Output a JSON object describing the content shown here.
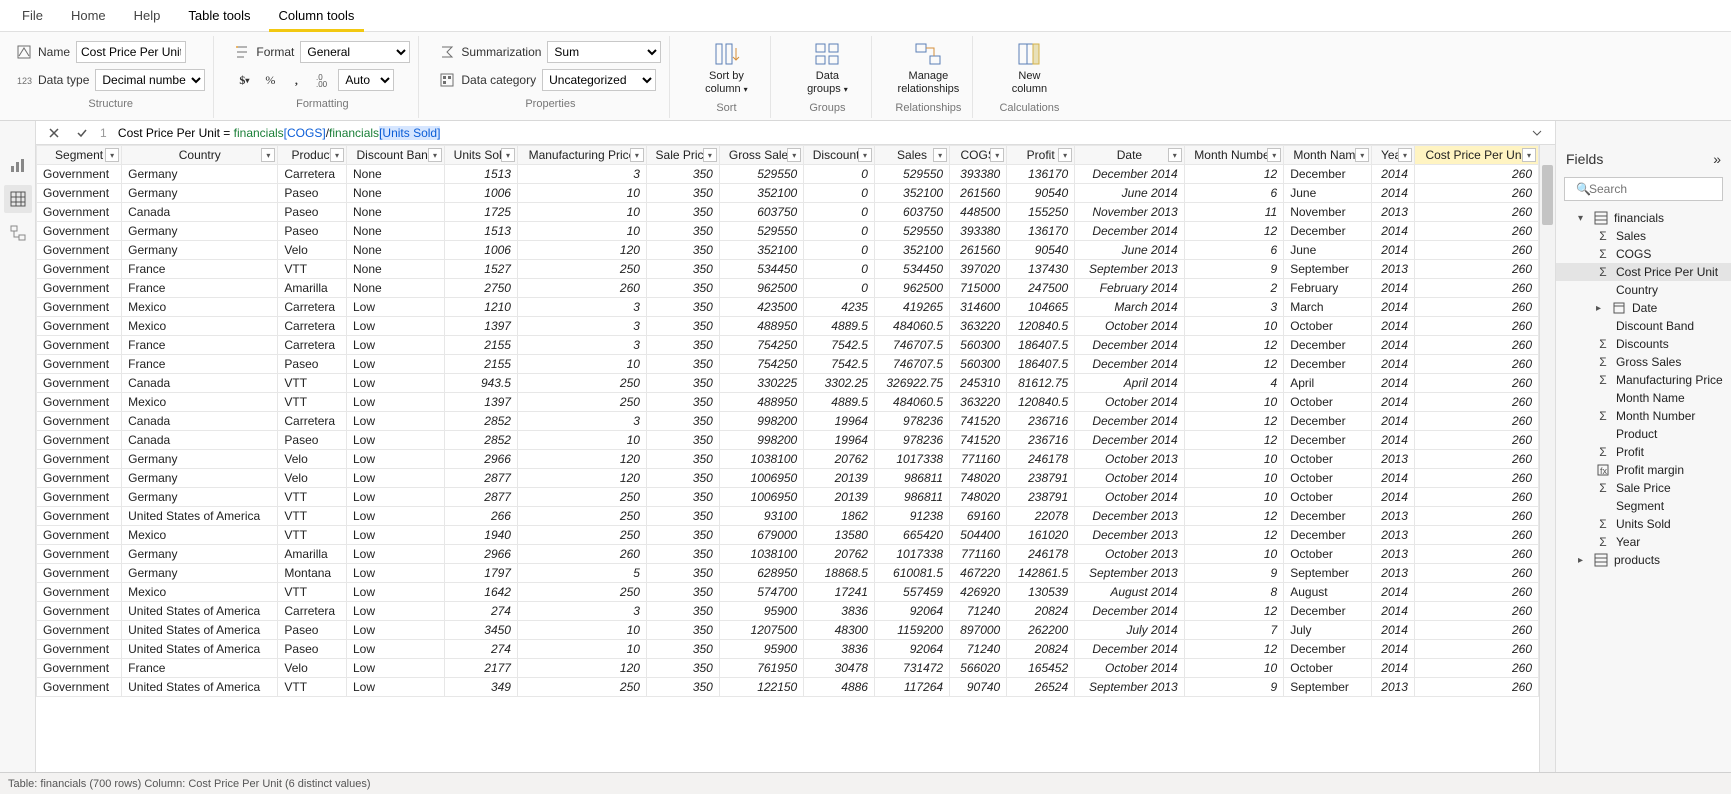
{
  "tabs": {
    "file": "File",
    "home": "Home",
    "help": "Help",
    "tabletools": "Table tools",
    "columntools": "Column tools"
  },
  "ribbon": {
    "structure": {
      "name_label": "Name",
      "name_value": "Cost Price Per Unit",
      "datatype_label": "Data type",
      "datatype_value": "Decimal number",
      "caption": "Structure"
    },
    "formatting": {
      "format_label": "Format",
      "format_value": "General",
      "auto_value": "Auto",
      "caption": "Formatting"
    },
    "properties": {
      "summarization_label": "Summarization",
      "summarization_value": "Sum",
      "datacategory_label": "Data category",
      "datacategory_value": "Uncategorized",
      "caption": "Properties"
    },
    "sort": {
      "label": "Sort by\ncolumn",
      "caption": "Sort"
    },
    "groups": {
      "label": "Data\ngroups",
      "caption": "Groups"
    },
    "relationships": {
      "label": "Manage\nrelationships",
      "caption": "Relationships"
    },
    "calculations": {
      "label": "New\ncolumn",
      "caption": "Calculations"
    }
  },
  "formula": {
    "lineno": "1",
    "lhs": "Cost Price Per Unit = ",
    "ref1": "financials",
    "col1": "[COGS]",
    "slash": "/",
    "ref2": "financials",
    "col2": "[Units Sold]"
  },
  "columns": [
    "Segment",
    "Country",
    "Product",
    "Discount Band",
    "Units Sold",
    "Manufacturing Price",
    "Sale Price",
    "Gross Sales",
    "Discounts",
    "Sales",
    "COGS",
    "Profit",
    "Date",
    "Month Number",
    "Month Name",
    "Year",
    "Cost Price Per Unit"
  ],
  "col_align": [
    "text",
    "text",
    "text",
    "text",
    "num",
    "num",
    "num",
    "num",
    "num",
    "num",
    "num",
    "num",
    "num",
    "num",
    "text",
    "num",
    "num"
  ],
  "rows": [
    [
      "Government",
      "Germany",
      "Carretera",
      "None",
      "1513",
      "3",
      "350",
      "529550",
      "0",
      "529550",
      "393380",
      "136170",
      "December 2014",
      "12",
      "December",
      "2014",
      "260"
    ],
    [
      "Government",
      "Germany",
      "Paseo",
      "None",
      "1006",
      "10",
      "350",
      "352100",
      "0",
      "352100",
      "261560",
      "90540",
      "June 2014",
      "6",
      "June",
      "2014",
      "260"
    ],
    [
      "Government",
      "Canada",
      "Paseo",
      "None",
      "1725",
      "10",
      "350",
      "603750",
      "0",
      "603750",
      "448500",
      "155250",
      "November 2013",
      "11",
      "November",
      "2013",
      "260"
    ],
    [
      "Government",
      "Germany",
      "Paseo",
      "None",
      "1513",
      "10",
      "350",
      "529550",
      "0",
      "529550",
      "393380",
      "136170",
      "December 2014",
      "12",
      "December",
      "2014",
      "260"
    ],
    [
      "Government",
      "Germany",
      "Velo",
      "None",
      "1006",
      "120",
      "350",
      "352100",
      "0",
      "352100",
      "261560",
      "90540",
      "June 2014",
      "6",
      "June",
      "2014",
      "260"
    ],
    [
      "Government",
      "France",
      "VTT",
      "None",
      "1527",
      "250",
      "350",
      "534450",
      "0",
      "534450",
      "397020",
      "137430",
      "September 2013",
      "9",
      "September",
      "2013",
      "260"
    ],
    [
      "Government",
      "France",
      "Amarilla",
      "None",
      "2750",
      "260",
      "350",
      "962500",
      "0",
      "962500",
      "715000",
      "247500",
      "February 2014",
      "2",
      "February",
      "2014",
      "260"
    ],
    [
      "Government",
      "Mexico",
      "Carretera",
      "Low",
      "1210",
      "3",
      "350",
      "423500",
      "4235",
      "419265",
      "314600",
      "104665",
      "March 2014",
      "3",
      "March",
      "2014",
      "260"
    ],
    [
      "Government",
      "Mexico",
      "Carretera",
      "Low",
      "1397",
      "3",
      "350",
      "488950",
      "4889.5",
      "484060.5",
      "363220",
      "120840.5",
      "October 2014",
      "10",
      "October",
      "2014",
      "260"
    ],
    [
      "Government",
      "France",
      "Carretera",
      "Low",
      "2155",
      "3",
      "350",
      "754250",
      "7542.5",
      "746707.5",
      "560300",
      "186407.5",
      "December 2014",
      "12",
      "December",
      "2014",
      "260"
    ],
    [
      "Government",
      "France",
      "Paseo",
      "Low",
      "2155",
      "10",
      "350",
      "754250",
      "7542.5",
      "746707.5",
      "560300",
      "186407.5",
      "December 2014",
      "12",
      "December",
      "2014",
      "260"
    ],
    [
      "Government",
      "Canada",
      "VTT",
      "Low",
      "943.5",
      "250",
      "350",
      "330225",
      "3302.25",
      "326922.75",
      "245310",
      "81612.75",
      "April 2014",
      "4",
      "April",
      "2014",
      "260"
    ],
    [
      "Government",
      "Mexico",
      "VTT",
      "Low",
      "1397",
      "250",
      "350",
      "488950",
      "4889.5",
      "484060.5",
      "363220",
      "120840.5",
      "October 2014",
      "10",
      "October",
      "2014",
      "260"
    ],
    [
      "Government",
      "Canada",
      "Carretera",
      "Low",
      "2852",
      "3",
      "350",
      "998200",
      "19964",
      "978236",
      "741520",
      "236716",
      "December 2014",
      "12",
      "December",
      "2014",
      "260"
    ],
    [
      "Government",
      "Canada",
      "Paseo",
      "Low",
      "2852",
      "10",
      "350",
      "998200",
      "19964",
      "978236",
      "741520",
      "236716",
      "December 2014",
      "12",
      "December",
      "2014",
      "260"
    ],
    [
      "Government",
      "Germany",
      "Velo",
      "Low",
      "2966",
      "120",
      "350",
      "1038100",
      "20762",
      "1017338",
      "771160",
      "246178",
      "October 2013",
      "10",
      "October",
      "2013",
      "260"
    ],
    [
      "Government",
      "Germany",
      "Velo",
      "Low",
      "2877",
      "120",
      "350",
      "1006950",
      "20139",
      "986811",
      "748020",
      "238791",
      "October 2014",
      "10",
      "October",
      "2014",
      "260"
    ],
    [
      "Government",
      "Germany",
      "VTT",
      "Low",
      "2877",
      "250",
      "350",
      "1006950",
      "20139",
      "986811",
      "748020",
      "238791",
      "October 2014",
      "10",
      "October",
      "2014",
      "260"
    ],
    [
      "Government",
      "United States of America",
      "VTT",
      "Low",
      "266",
      "250",
      "350",
      "93100",
      "1862",
      "91238",
      "69160",
      "22078",
      "December 2013",
      "12",
      "December",
      "2013",
      "260"
    ],
    [
      "Government",
      "Mexico",
      "VTT",
      "Low",
      "1940",
      "250",
      "350",
      "679000",
      "13580",
      "665420",
      "504400",
      "161020",
      "December 2013",
      "12",
      "December",
      "2013",
      "260"
    ],
    [
      "Government",
      "Germany",
      "Amarilla",
      "Low",
      "2966",
      "260",
      "350",
      "1038100",
      "20762",
      "1017338",
      "771160",
      "246178",
      "October 2013",
      "10",
      "October",
      "2013",
      "260"
    ],
    [
      "Government",
      "Germany",
      "Montana",
      "Low",
      "1797",
      "5",
      "350",
      "628950",
      "18868.5",
      "610081.5",
      "467220",
      "142861.5",
      "September 2013",
      "9",
      "September",
      "2013",
      "260"
    ],
    [
      "Government",
      "Mexico",
      "VTT",
      "Low",
      "1642",
      "250",
      "350",
      "574700",
      "17241",
      "557459",
      "426920",
      "130539",
      "August 2014",
      "8",
      "August",
      "2014",
      "260"
    ],
    [
      "Government",
      "United States of America",
      "Carretera",
      "Low",
      "274",
      "3",
      "350",
      "95900",
      "3836",
      "92064",
      "71240",
      "20824",
      "December 2014",
      "12",
      "December",
      "2014",
      "260"
    ],
    [
      "Government",
      "United States of America",
      "Paseo",
      "Low",
      "3450",
      "10",
      "350",
      "1207500",
      "48300",
      "1159200",
      "897000",
      "262200",
      "July 2014",
      "7",
      "July",
      "2014",
      "260"
    ],
    [
      "Government",
      "United States of America",
      "Paseo",
      "Low",
      "274",
      "10",
      "350",
      "95900",
      "3836",
      "92064",
      "71240",
      "20824",
      "December 2014",
      "12",
      "December",
      "2014",
      "260"
    ],
    [
      "Government",
      "France",
      "Velo",
      "Low",
      "2177",
      "120",
      "350",
      "761950",
      "30478",
      "731472",
      "566020",
      "165452",
      "October 2014",
      "10",
      "October",
      "2014",
      "260"
    ],
    [
      "Government",
      "United States of America",
      "VTT",
      "Low",
      "349",
      "250",
      "350",
      "122150",
      "4886",
      "117264",
      "90740",
      "26524",
      "September 2013",
      "9",
      "September",
      "2013",
      "260"
    ]
  ],
  "fields": {
    "title": "Fields",
    "search_placeholder": "Search",
    "tables": [
      {
        "name": "financials",
        "expanded": true,
        "items": [
          {
            "name": "Sales",
            "sigma": true
          },
          {
            "name": "COGS",
            "sigma": true
          },
          {
            "name": "Cost Price Per Unit",
            "sigma": true,
            "selected": true
          },
          {
            "name": "Country"
          },
          {
            "name": "Date",
            "expandable": true
          },
          {
            "name": "Discount Band"
          },
          {
            "name": "Discounts",
            "sigma": true
          },
          {
            "name": "Gross Sales",
            "sigma": true
          },
          {
            "name": "Manufacturing Price",
            "sigma": true
          },
          {
            "name": "Month Name"
          },
          {
            "name": "Month Number",
            "sigma": true
          },
          {
            "name": "Product"
          },
          {
            "name": "Profit",
            "sigma": true
          },
          {
            "name": "Profit margin",
            "measure": true
          },
          {
            "name": "Sale Price",
            "sigma": true
          },
          {
            "name": "Segment"
          },
          {
            "name": "Units Sold",
            "sigma": true
          },
          {
            "name": "Year",
            "sigma": true
          }
        ]
      },
      {
        "name": "products",
        "expanded": false,
        "items": []
      }
    ]
  },
  "status": "Table: financials (700 rows) Column: Cost Price Per Unit (6 distinct values)"
}
